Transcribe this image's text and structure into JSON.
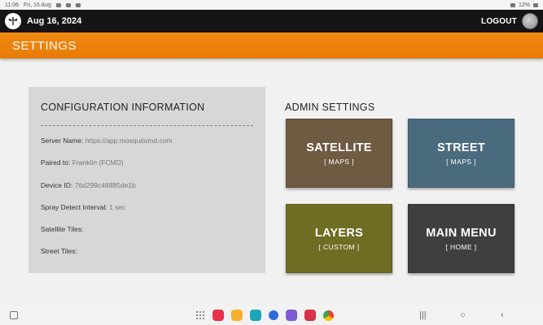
{
  "statusbar": {
    "time": "11:06",
    "date": "Fri, 16 Aug",
    "battery": "12%"
  },
  "appbar": {
    "date": "Aug 16, 2024",
    "logout_label": "LOGOUT"
  },
  "header": {
    "title": "SETTINGS"
  },
  "config": {
    "title": "CONFIGURATION INFORMATION",
    "rows": [
      {
        "key": "Server Name:",
        "value": "https://app.mosquitomd.com"
      },
      {
        "key": "Paired to:",
        "value": "Franklin (FCMD)"
      },
      {
        "key": "Device ID:",
        "value": "76d299c48885de1b"
      },
      {
        "key": "Spray Detect Interval:",
        "value": "1 sec"
      },
      {
        "key": "Satellite Tiles:",
        "value": ""
      },
      {
        "key": "Street Tiles:",
        "value": ""
      }
    ]
  },
  "admin": {
    "title": "ADMIN SETTINGS",
    "tiles": [
      {
        "label": "SATELLITE",
        "sub": "[ MAPS ]",
        "color": "#6f5a42"
      },
      {
        "label": "STREET",
        "sub": "[ MAPS ]",
        "color": "#4a6b7d"
      },
      {
        "label": "LAYERS",
        "sub": "[ CUSTOM ]",
        "color": "#6f6c24"
      },
      {
        "label": "MAIN MENU",
        "sub": "[ HOME ]",
        "color": "#3f3f3f"
      }
    ]
  },
  "colors": {
    "accent": "#ef8410",
    "appbar": "#151515"
  },
  "taskbar": {
    "apps": [
      "app-drawer-icon",
      "red-app-icon",
      "files-icon",
      "teal-app-icon",
      "messages-icon",
      "purple-app-icon",
      "screen-recorder-icon",
      "chrome-icon"
    ]
  }
}
